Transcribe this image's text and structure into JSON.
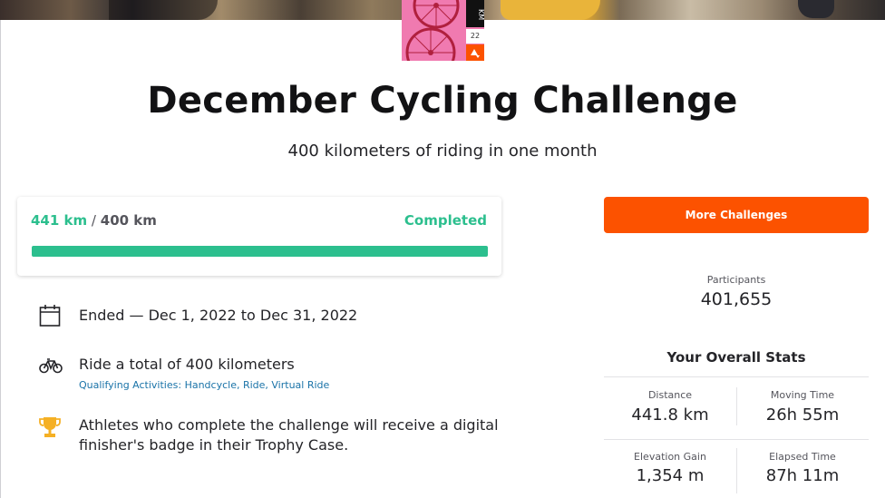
{
  "challenge": {
    "title": "December Cycling Challenge",
    "subtitle": "400 kilometers of riding in one month",
    "badge": {
      "km_text": "KM",
      "number_text": "22"
    }
  },
  "progress": {
    "current": "441 km",
    "separator": "/",
    "goal": "400 km",
    "status": "Completed",
    "fraction": 1.0
  },
  "details": [
    {
      "icon": "calendar-icon",
      "text": "Ended — Dec 1, 2022 to Dec 31, 2022"
    },
    {
      "icon": "bike-icon",
      "text": "Ride a total of 400 kilometers",
      "sub": "Qualifying Activities: Handcycle, Ride, Virtual Ride"
    },
    {
      "icon": "trophy-icon",
      "text": "Athletes who complete the challenge will receive a digital finisher's badge in their Trophy Case."
    }
  ],
  "sidebar": {
    "more_button": "More Challenges",
    "participants_label": "Participants",
    "participants_value": "401,655",
    "stats_title": "Your Overall Stats",
    "stats": [
      {
        "label": "Distance",
        "value": "441.8 km"
      },
      {
        "label": "Moving Time",
        "value": "26h 55m"
      },
      {
        "label": "Elevation Gain",
        "value": "1,354 m"
      },
      {
        "label": "Elapsed Time",
        "value": "87h 11m"
      }
    ]
  },
  "colors": {
    "accent": "#fc5200",
    "success": "#2cbf8e",
    "badge_pink": "#f07ab0",
    "link": "#1a73a8",
    "trophy": "#f5b025"
  }
}
